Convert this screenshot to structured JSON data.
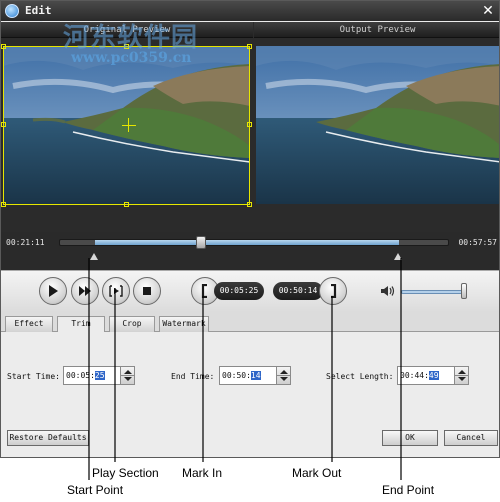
{
  "window": {
    "title": "Edit",
    "close_icon": "close-icon"
  },
  "watermark": {
    "text_cn": "河东软件园",
    "url": "www.pc0359.cn"
  },
  "preview": {
    "original_label": "Original Preview",
    "output_label": "Output Preview"
  },
  "timeline": {
    "current_time": "00:21:11",
    "total_time": "00:57:57",
    "selection_start_fraction": 0.09,
    "selection_end_fraction": 0.87,
    "playhead_fraction": 0.365
  },
  "controls": {
    "play_icon": "play-icon",
    "next_frame_icon": "next-frame-icon",
    "play_section_icon": "play-section-icon",
    "stop_icon": "stop-icon",
    "mark_in_icon": "mark-in-icon",
    "mark_out_icon": "mark-out-icon",
    "mark_in_time": "00:05:25",
    "mark_out_time": "00:50:14",
    "volume_icon": "speaker-icon",
    "volume_level": 0.95
  },
  "tabs": [
    {
      "label": "Effect",
      "active": false
    },
    {
      "label": "Trim",
      "active": true
    },
    {
      "label": "Crop",
      "active": false
    },
    {
      "label": "Watermark",
      "active": false
    }
  ],
  "trim": {
    "start_label": "Start Time:",
    "start_value_prefix": "00:05:",
    "start_value_selected": "25",
    "end_label": "End Time:",
    "end_value_prefix": "00:50:",
    "end_value_selected": "14",
    "length_label": "Select Length:",
    "length_value_prefix": "00:44:",
    "length_value_selected": "49"
  },
  "buttons": {
    "restore_defaults": "Restore Defaults",
    "ok": "OK",
    "cancel": "Cancel"
  },
  "callouts": {
    "play_section": "Play Section",
    "mark_in": "Mark In",
    "mark_out": "Mark Out",
    "start_point": "Start Point",
    "end_point": "End Point"
  },
  "colors": {
    "crop_frame": "#e6e600",
    "selection": "#8fb8dc",
    "spin_highlight": "#2f66c8"
  }
}
